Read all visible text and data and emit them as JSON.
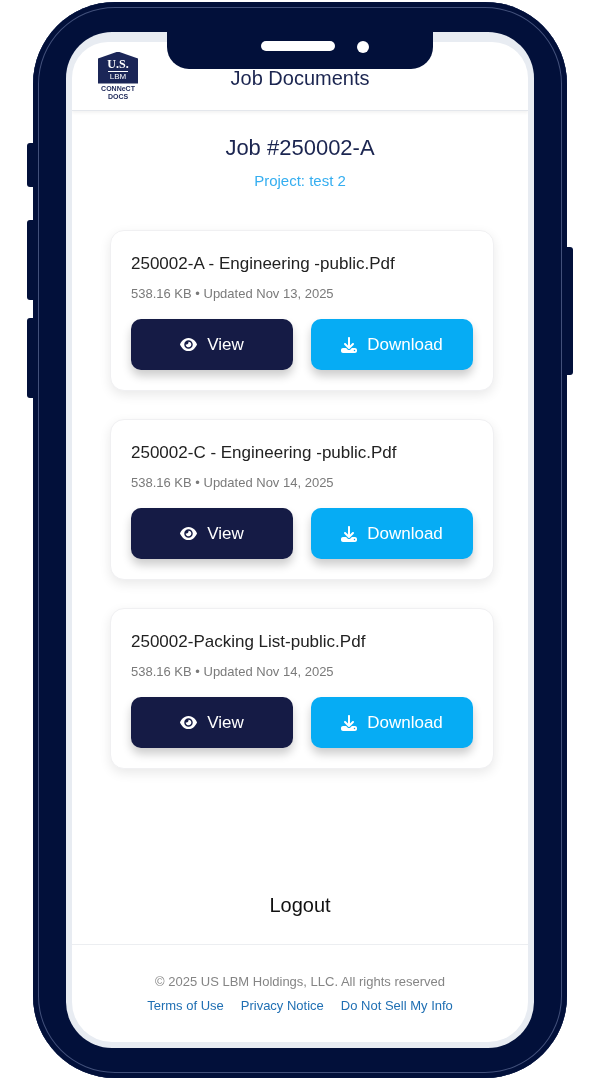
{
  "header": {
    "logo": {
      "badge_text": "U.S.",
      "badge_subtext": "LBM",
      "wordmark_line_1": "CONNeCT",
      "wordmark_line_2": "DOCS"
    },
    "title": "Job Documents"
  },
  "job": {
    "title": "Job #250002-A",
    "project": "Project: test 2"
  },
  "documents": [
    {
      "name": "250002-A - Engineering -public.Pdf",
      "meta": "538.16 KB • Updated Nov 13, 2025",
      "actions": [
        {
          "kind": "view",
          "label": "View"
        },
        {
          "kind": "download",
          "label": "Download"
        }
      ]
    },
    {
      "name": "250002-C - Engineering -public.Pdf",
      "meta": "538.16 KB • Updated Nov 14, 2025",
      "actions": [
        {
          "kind": "view",
          "label": "View"
        },
        {
          "kind": "download",
          "label": "Download"
        }
      ]
    },
    {
      "name": "250002-Packing List-public.Pdf",
      "meta": "538.16 KB • Updated Nov 14, 2025",
      "actions": [
        {
          "kind": "view",
          "label": "View"
        },
        {
          "kind": "download",
          "label": "Download"
        }
      ]
    }
  ],
  "logout": "Logout",
  "footer": {
    "copyright": "© 2025 US LBM Holdings, LLC. All rights reserved",
    "links": [
      "Terms of Use",
      "Privacy Notice",
      "Do Not Sell My Info"
    ]
  }
}
